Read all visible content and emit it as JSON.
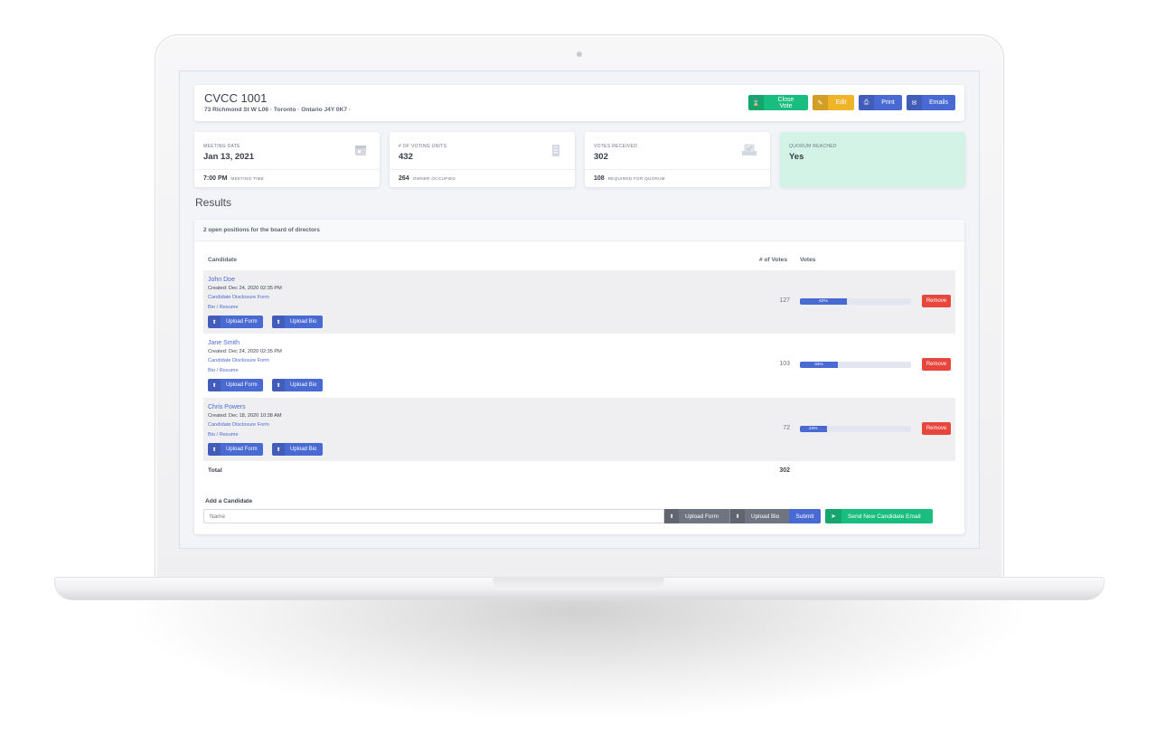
{
  "header": {
    "title": "CVCC 1001",
    "address": "73 Richmond St W L06 · Toronto · Ontario J4Y 0K7 ·",
    "buttons": {
      "close_vote": "Close Vote",
      "edit": "Edit",
      "print": "Print",
      "emails": "Emails"
    }
  },
  "stats": {
    "meeting": {
      "caption": "MEETING DATE",
      "value": "Jan 13, 2021",
      "foot_value": "7:00 PM",
      "foot_label": "MEETING TIME",
      "icon": "calendar-icon"
    },
    "units": {
      "caption": "# OF VOTING UNITS",
      "value": "432",
      "foot_value": "264",
      "foot_label": "OWNER OCCUPIED",
      "icon": "building-icon"
    },
    "votes": {
      "caption": "VOTES RECEIVED",
      "value": "302",
      "foot_value": "108",
      "foot_label": "REQUIRED FOR QUORUM",
      "icon": "ballot-box-icon"
    },
    "quorum": {
      "caption": "QUORUM REACHED",
      "value": "Yes"
    }
  },
  "results": {
    "title": "Results",
    "subhead": "2 open positions for the board of directors",
    "columns": {
      "candidate": "Candidate",
      "num_votes": "# of Votes",
      "votes": "Votes"
    },
    "candidates": [
      {
        "name": "John Doe",
        "created": "Created: Dec 24, 2020 02:35 PM",
        "disclosure": "Candidate Disclosure Form",
        "bio": "Bio / Resume",
        "upload_form": "Upload Form",
        "upload_bio": "Upload Bio",
        "votes": "127",
        "percent": 42,
        "percent_label": "42%",
        "remove": "Remove"
      },
      {
        "name": "Jane Smith",
        "created": "Created: Dec 24, 2020 02:35 PM",
        "disclosure": "Candidate Disclosure Form",
        "bio": "Bio / Resume",
        "upload_form": "Upload Form",
        "upload_bio": "Upload Bio",
        "votes": "103",
        "percent": 34,
        "percent_label": "34%",
        "remove": "Remove"
      },
      {
        "name": "Chris Powers",
        "created": "Created: Dec 18, 2020 10:38 AM",
        "disclosure": "Candidate Disclosure Form",
        "bio": "Bio / Resume",
        "upload_form": "Upload Form",
        "upload_bio": "Upload Bio",
        "votes": "72",
        "percent": 24,
        "percent_label": "24%",
        "remove": "Remove"
      }
    ],
    "total_label": "Total",
    "total_value": "302"
  },
  "add_candidate": {
    "label": "Add a Candidate",
    "placeholder": "Name",
    "upload_form": "Upload Form",
    "upload_bio": "Upload Bio",
    "submit": "Submit",
    "send_email": "Send New Candidate Email"
  },
  "colors": {
    "primary": "#4a6ad3",
    "success": "#19bd7f",
    "warning": "#f0b429",
    "danger": "#e8453c",
    "quorum_bg": "#d3f3e6"
  }
}
